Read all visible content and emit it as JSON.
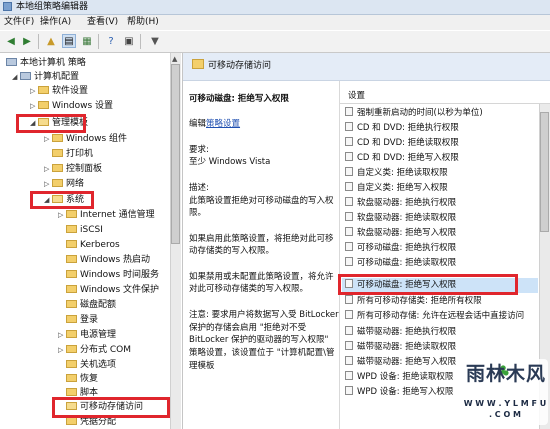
{
  "window": {
    "title": "本地组策略编辑器"
  },
  "menu": [
    "文件(F)",
    "操作(A)",
    "查看(V)",
    "帮助(H)"
  ],
  "tree": {
    "root": "本地计算机 策略",
    "items": [
      {
        "label": "计算机配置"
      },
      {
        "label": "软件设置"
      },
      {
        "label": "Windows 设置"
      },
      {
        "label": "管理模板"
      },
      {
        "label": "Windows 组件"
      },
      {
        "label": "打印机"
      },
      {
        "label": "控制面板"
      },
      {
        "label": "网络"
      },
      {
        "label": "系统"
      },
      {
        "label": "Internet 通信管理"
      },
      {
        "label": "iSCSI"
      },
      {
        "label": "Kerberos"
      },
      {
        "label": "Windows 热启动"
      },
      {
        "label": "Windows 时间服务"
      },
      {
        "label": "Windows 文件保护"
      },
      {
        "label": "磁盘配额"
      },
      {
        "label": "登录"
      },
      {
        "label": "电源管理"
      },
      {
        "label": "分布式 COM"
      },
      {
        "label": "关机选项"
      },
      {
        "label": "恢复"
      },
      {
        "label": "脚本"
      },
      {
        "label": "可移动存储访问"
      },
      {
        "label": "凭据分配"
      }
    ]
  },
  "detail": {
    "header": "可移动存储访问",
    "policy_title": "可移动磁盘: 拒绝写入权限",
    "edit_prefix": "编辑",
    "edit_link": "策略设置",
    "requirements_label": "要求:",
    "requirements_value": "至少 Windows Vista",
    "description_label": "描述:",
    "description": "此策略设置拒绝对可移动磁盘的写入权限。",
    "enabled_text": "如果启用此策略设置，将拒绝对此可移动存储类的写入权限。",
    "disabled_text": "如果禁用或未配置此策略设置，将允许对此可移动存储类的写入权限。",
    "note_text": "注意: 要求用户将数据写入受 BitLocker 保护的存储会启用 \"拒绝对不受 BitLocker 保护的驱动器的写入权限\" 策略设置，该设置位于 \"计算机配置\\管理模板"
  },
  "list": {
    "header": "设置",
    "items": [
      "强制重新启动的时间(以秒为单位)",
      "CD 和 DVD: 拒绝执行权限",
      "CD 和 DVD: 拒绝读取权限",
      "CD 和 DVD: 拒绝写入权限",
      "自定义类: 拒绝读取权限",
      "自定义类: 拒绝写入权限",
      "软盘驱动器: 拒绝执行权限",
      "软盘驱动器: 拒绝读取权限",
      "软盘驱动器: 拒绝写入权限",
      "可移动磁盘: 拒绝执行权限",
      "可移动磁盘: 拒绝读取权限",
      "可移动磁盘: 拒绝写入权限",
      "所有可移动存储类: 拒绝所有权限",
      "所有可移动存储: 允许在远程会话中直接访问",
      "磁带驱动器: 拒绝执行权限",
      "磁带驱动器: 拒绝读取权限",
      "磁带驱动器: 拒绝写入权限",
      "WPD 设备: 拒绝读取权限",
      "WPD 设备: 拒绝写入权限"
    ]
  },
  "watermark": {
    "title": "雨林木风",
    "url": "W W W . Y L M F U . C O M"
  },
  "colors": {
    "highlight_box": "#e0262d",
    "selected_row": "#cde3f8",
    "header_bg": "#e4ecf7"
  }
}
